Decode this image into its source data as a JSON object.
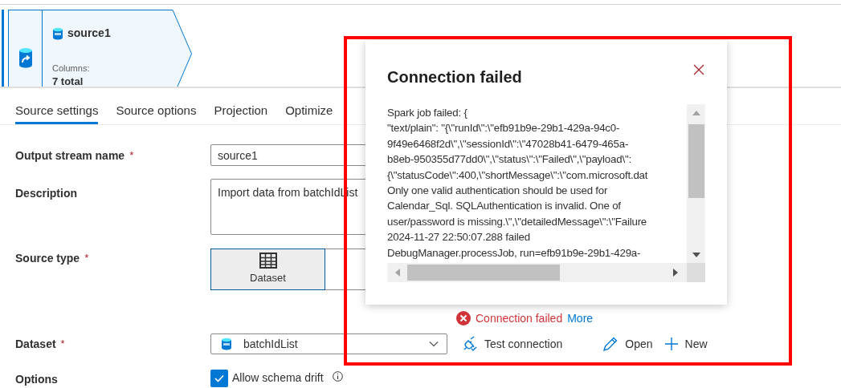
{
  "node": {
    "title": "source1",
    "columns_label": "Columns:",
    "columns_value": "7 total"
  },
  "tabs": [
    {
      "label": "Source settings",
      "selected": true
    },
    {
      "label": "Source options",
      "selected": false
    },
    {
      "label": "Projection",
      "selected": false
    },
    {
      "label": "Optimize",
      "selected": false
    }
  ],
  "fields": [
    {
      "kind": "text",
      "label": "Output stream name",
      "required_mark": "*",
      "value": "source1"
    },
    {
      "kind": "textarea",
      "label": "Description",
      "value": "Import data from batchIdList"
    },
    {
      "kind": "choice",
      "label": "Source type",
      "required_mark": "*",
      "options": [
        {
          "label": "Dataset",
          "selected": true
        },
        {
          "selected": false
        }
      ]
    },
    {
      "kind": "dataset",
      "label": "Dataset",
      "required_mark": "*",
      "value": "batchIdList",
      "status": {
        "text": "Connection failed",
        "link": "More"
      },
      "actions": [
        {
          "kind": "test",
          "label": "Test connection"
        },
        {
          "kind": "open",
          "label": "Open"
        },
        {
          "kind": "new",
          "label": "New"
        }
      ]
    },
    {
      "kind": "checkbox",
      "label": "Options",
      "checkbox_label": "Allow schema drift",
      "checked": true
    }
  ],
  "dialog": {
    "title": "Connection failed",
    "lines": [
      "Spark job failed: {",
      "\"text/plain\": \"{\\\"runId\\\":\\\"efb91b9e-29b1-429a-94c0-",
      "9f49e6468f2d\\\",\\\"sessionId\\\":\\\"47028b41-6479-465a-",
      "b8eb-950355d77dd0\\\",\\\"status\\\":\\\"Failed\\\",\\\"payload\\\":",
      "{\\\"statusCode\\\":400,\\\"shortMessage\\\":\\\"com.microsoft.dat",
      "Only one valid authentication should be used for",
      "Calendar_Sql. SQLAuthentication is invalid. One of",
      "user/password is missing.\\\",\\\"detailedMessage\\\":\\\"Failure",
      "2024-11-27 22:50:07.288 failed",
      "DebugManager.processJob, run=efb91b9e-29b1-429a-"
    ]
  }
}
